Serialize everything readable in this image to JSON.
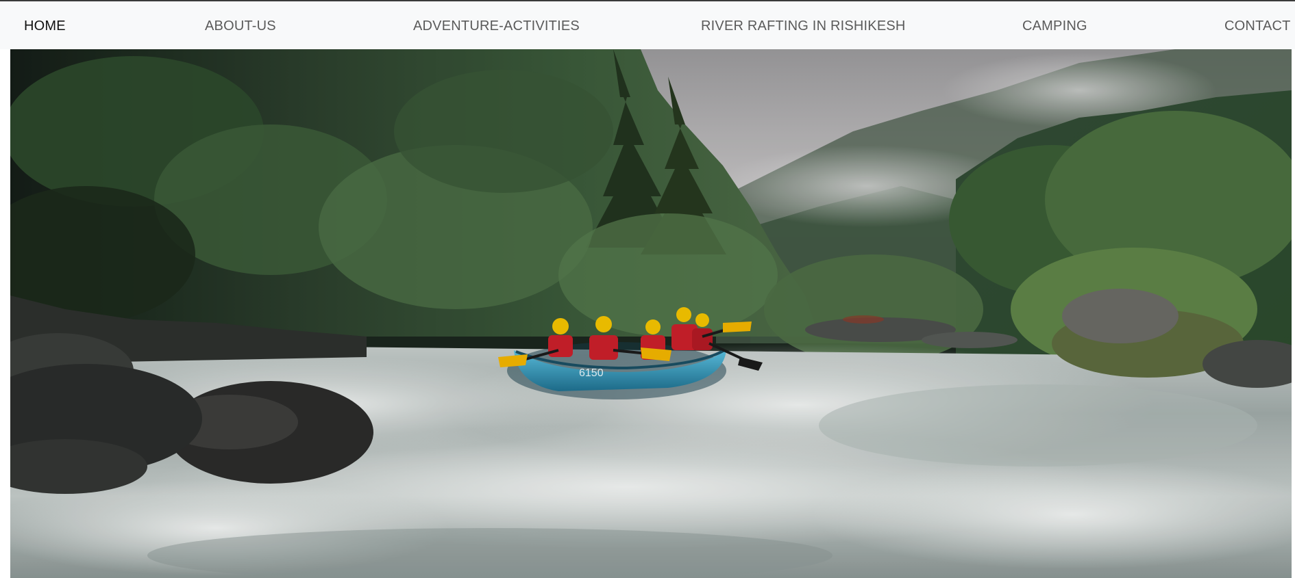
{
  "navbar": {
    "items": [
      {
        "label": "HOME",
        "active": true
      },
      {
        "label": "ABOUT-US",
        "active": false
      },
      {
        "label": "ADVENTURE-ACTIVITIES",
        "active": false
      },
      {
        "label": "RIVER RAFTING IN RISHIKESH",
        "active": false
      },
      {
        "label": "CAMPING",
        "active": false
      },
      {
        "label": "CONTACT",
        "active": false
      }
    ]
  },
  "hero": {
    "image_subject": "white-water-rafting-photo",
    "raft_label": "6150"
  },
  "colors": {
    "navbar_bg": "#f8f9fa",
    "nav_active": "#111111",
    "nav_inactive": "#5a5a5a",
    "raft": "#3aa3c9",
    "life_jacket": "#c8202a",
    "helmet": "#f2c200",
    "paddle": "#f0b400"
  }
}
